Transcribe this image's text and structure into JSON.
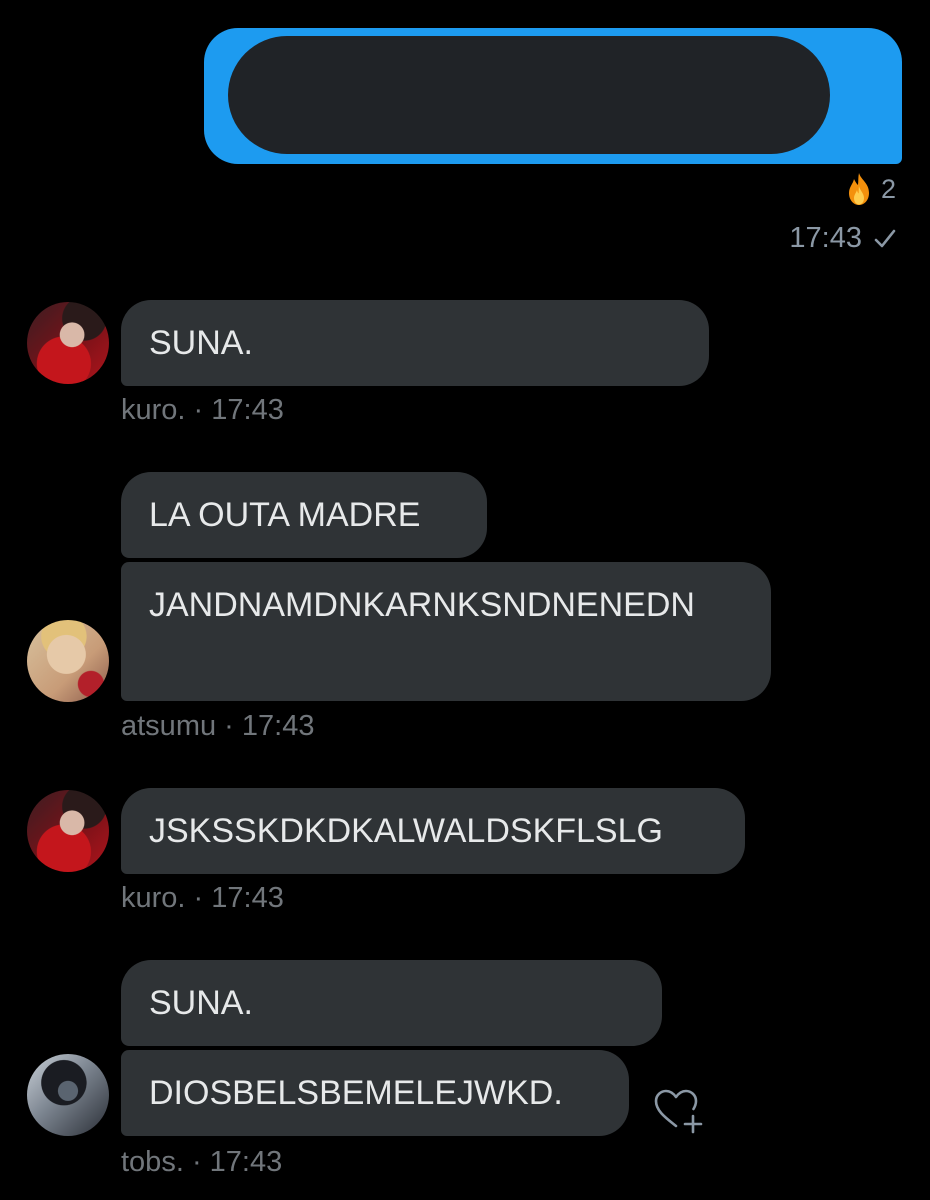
{
  "outgoing": {
    "reaction_icon": "fire-emoji",
    "reaction_count": "2",
    "time": "17:43",
    "status_icon": "check-icon",
    "accent_color": "#1d9bf0"
  },
  "messages": [
    {
      "sender": "kuro.",
      "time": "17:43",
      "separator": "·",
      "bubbles": [
        "SUNA."
      ]
    },
    {
      "sender": "atsumu",
      "time": "17:43",
      "separator": "·",
      "bubbles": [
        "LA OUTA MADRE",
        "JANDNAMDNKARNKSNDNENEDN"
      ]
    },
    {
      "sender": "kuro.",
      "time": "17:43",
      "separator": "·",
      "bubbles": [
        "JSKSSKDKDKALWALDSKFLSLG"
      ]
    },
    {
      "sender": "tobs.",
      "time": "17:43",
      "separator": "·",
      "bubbles": [
        "SUNA.",
        "DIOSBELSBEMELEJWKD."
      ]
    }
  ],
  "react_button_icon": "heart-plus-icon"
}
